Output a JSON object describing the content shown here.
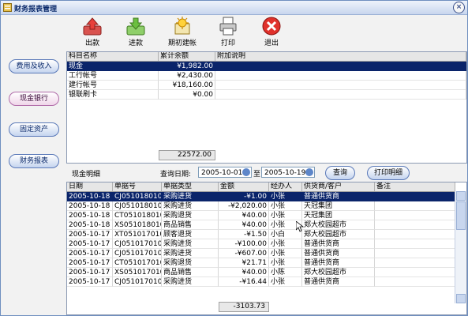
{
  "window": {
    "title": "财务报表管理",
    "close": "×"
  },
  "toolbar": {
    "out_label": "出款",
    "in_label": "进款",
    "opening_label": "期初建帐",
    "print_label": "打印",
    "exit_label": "退出"
  },
  "sidebar": {
    "items": [
      {
        "label": "费用及收入"
      },
      {
        "label": "现金银行"
      },
      {
        "label": "固定资产"
      },
      {
        "label": "财务报表"
      }
    ]
  },
  "accounts": {
    "headers": [
      "科目名称",
      "累计余额",
      "附加说明"
    ],
    "rows": [
      {
        "name": "现金",
        "balance": "¥1,982.00",
        "note": ""
      },
      {
        "name": "工行帐号",
        "balance": "¥2,430.00",
        "note": ""
      },
      {
        "name": "建行帐号",
        "balance": "¥18,160.00",
        "note": ""
      },
      {
        "name": "银联刷卡",
        "balance": "¥0.00",
        "note": ""
      }
    ],
    "total": "22572.00"
  },
  "query": {
    "section_label": "现金明细",
    "date_label": "查询日期:",
    "from": "2005-10-01",
    "to_label": "至",
    "to": "2005-10-19",
    "query_button": "查询",
    "print_detail_button": "打印明细"
  },
  "details": {
    "headers": [
      "日期",
      "单据号",
      "单据类型",
      "金额",
      "经办人",
      "供货商/客户",
      "备注"
    ],
    "rows": [
      {
        "date": "2005-10-18",
        "no": "CJ051018010004",
        "type": "采购进货",
        "amount": "-¥1.00",
        "handler": "小张",
        "partner": "普通供货商",
        "note": ""
      },
      {
        "date": "2005-10-18",
        "no": "CJ051018010003",
        "type": "采购进货",
        "amount": "-¥2,020.00",
        "handler": "小张",
        "partner": "天冠集团",
        "note": ""
      },
      {
        "date": "2005-10-18",
        "no": "CT051018010001",
        "type": "采购退货",
        "amount": "¥40.00",
        "handler": "小张",
        "partner": "天冠集团",
        "note": ""
      },
      {
        "date": "2005-10-18",
        "no": "XS051018010001",
        "type": "商品销售",
        "amount": "¥40.00",
        "handler": "小张",
        "partner": "郑大校园超市",
        "note": ""
      },
      {
        "date": "2005-10-17",
        "no": "XT051017010001",
        "type": "顾客退货",
        "amount": "-¥1.50",
        "handler": "小白",
        "partner": "郑大校园超市",
        "note": ""
      },
      {
        "date": "2005-10-17",
        "no": "CJ051017010001",
        "type": "采购进货",
        "amount": "-¥100.00",
        "handler": "小张",
        "partner": "普通供货商",
        "note": ""
      },
      {
        "date": "2005-10-17",
        "no": "CJ051017010002",
        "type": "采购进货",
        "amount": "-¥607.00",
        "handler": "小张",
        "partner": "普通供货商",
        "note": ""
      },
      {
        "date": "2005-10-17",
        "no": "CT051017010001",
        "type": "采购退货",
        "amount": "¥21.71",
        "handler": "小张",
        "partner": "普通供货商",
        "note": ""
      },
      {
        "date": "2005-10-17",
        "no": "XS051017010001",
        "type": "商品销售",
        "amount": "¥40.00",
        "handler": "小陈",
        "partner": "郑大校园超市",
        "note": ""
      },
      {
        "date": "2005-10-17",
        "no": "CJ051017010003",
        "type": "采购进货",
        "amount": "-¥16.44",
        "handler": "小张",
        "partner": "普通供货商",
        "note": ""
      }
    ],
    "total": "-3103.73"
  },
  "colors": {
    "selection": "#0a246a",
    "window_border": "#6f8fbf"
  }
}
